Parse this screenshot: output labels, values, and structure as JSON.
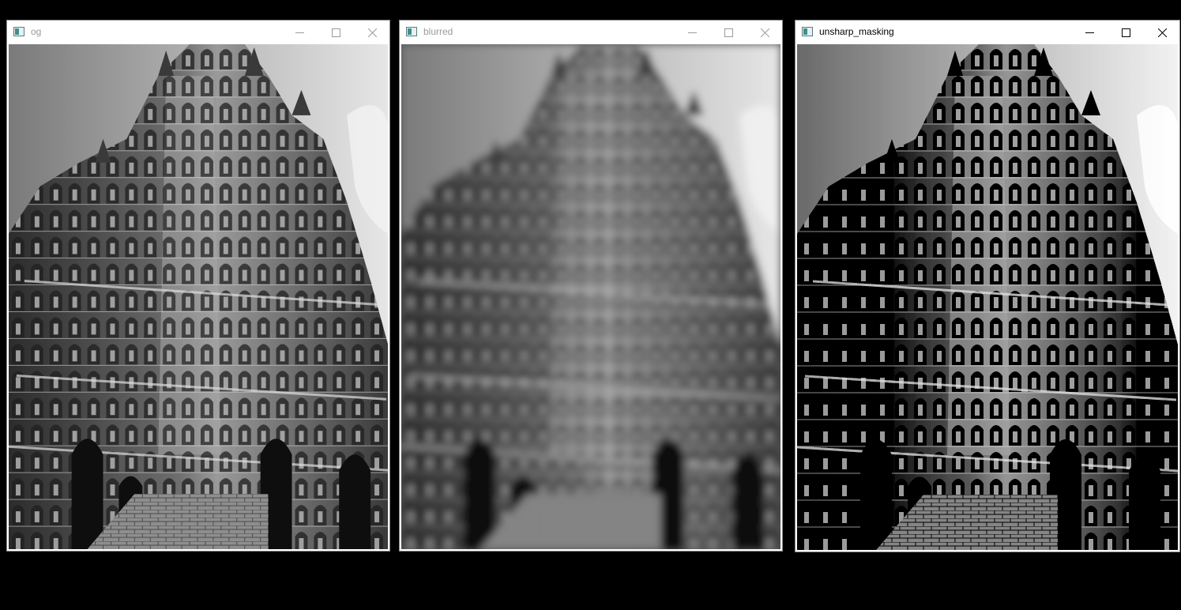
{
  "windows": [
    {
      "title": "og",
      "active": false,
      "icon": "opencv-window-icon",
      "image": "building-facade-original",
      "controls": [
        "minimize-icon",
        "maximize-icon",
        "close-icon"
      ]
    },
    {
      "title": "blurred",
      "active": false,
      "icon": "opencv-window-icon",
      "image": "building-facade-blurred",
      "controls": [
        "minimize-icon",
        "maximize-icon",
        "close-icon"
      ]
    },
    {
      "title": "unsharp_masking",
      "active": true,
      "icon": "opencv-window-icon",
      "image": "building-facade-sharpened",
      "controls": [
        "minimize-icon",
        "maximize-icon",
        "close-icon"
      ]
    }
  ],
  "colors": {
    "desktop": "#000000",
    "titlebar": "#ffffff",
    "inactive_title": "#9a9a9a",
    "active_title": "#000000"
  }
}
